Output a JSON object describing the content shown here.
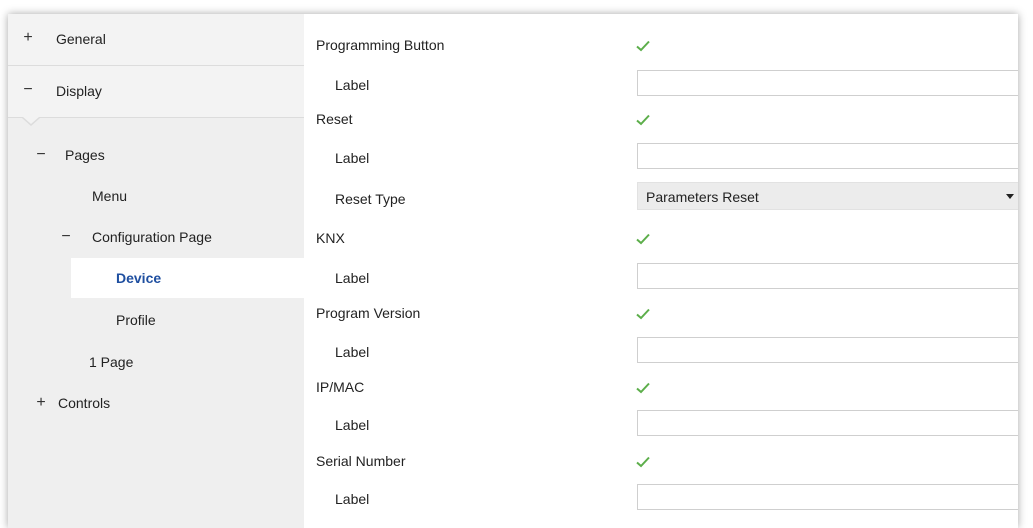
{
  "sidebar": {
    "general": {
      "symbol": "+",
      "label": "General"
    },
    "display": {
      "symbol": "−",
      "label": "Display"
    },
    "pages": {
      "symbol": "−",
      "label": "Pages"
    },
    "menu": {
      "label": "Menu"
    },
    "config_page": {
      "symbol": "−",
      "label": "Configuration Page"
    },
    "device": {
      "label": "Device"
    },
    "profile": {
      "label": "Profile"
    },
    "page1": {
      "label": "1 Page"
    },
    "controls": {
      "symbol": "+",
      "label": "Controls"
    }
  },
  "params": {
    "programming_button": {
      "label": "Programming Button",
      "checked": true
    },
    "prog_label": {
      "label": "Label",
      "value": ""
    },
    "reset": {
      "label": "Reset",
      "checked": true
    },
    "reset_label": {
      "label": "Label",
      "value": ""
    },
    "reset_type": {
      "label": "Reset Type",
      "value": "Parameters Reset"
    },
    "knx": {
      "label": "KNX",
      "checked": true
    },
    "knx_label": {
      "label": "Label",
      "value": ""
    },
    "program_version": {
      "label": "Program Version",
      "checked": true
    },
    "pv_label": {
      "label": "Label",
      "value": ""
    },
    "ip_mac": {
      "label": "IP/MAC",
      "checked": true
    },
    "ip_label": {
      "label": "Label",
      "value": ""
    },
    "serial_number": {
      "label": "Serial Number",
      "checked": true
    },
    "sn_label": {
      "label": "Label",
      "value": ""
    }
  },
  "colors": {
    "check": "#5cae4a",
    "selected_text": "#1f4fa0",
    "sidebar_bg": "#efefef"
  },
  "icons": {
    "checkbox": "checkmark-icon",
    "dropdown": "chevron-down-icon"
  }
}
